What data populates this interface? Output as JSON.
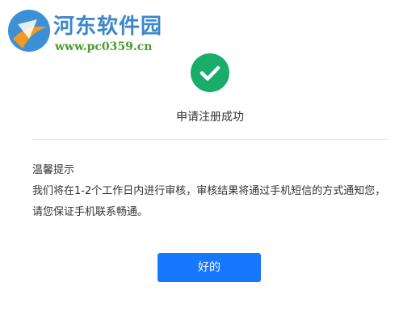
{
  "watermark": {
    "title": "河东软件园",
    "url": "www.pc0359.cn"
  },
  "success": {
    "icon": "check-circle-icon",
    "title": "申请注册成功"
  },
  "notice": {
    "heading": "温馨提示",
    "body": "我们将在1-2个工作日内进行审核，审核结果将通过手机短信的方式通知您，请您保证手机联系畅通。"
  },
  "actions": {
    "ok_label": "好的"
  },
  "colors": {
    "accent": "#1677ff",
    "success": "#1aad6a",
    "divider": "#e3e3e3"
  }
}
